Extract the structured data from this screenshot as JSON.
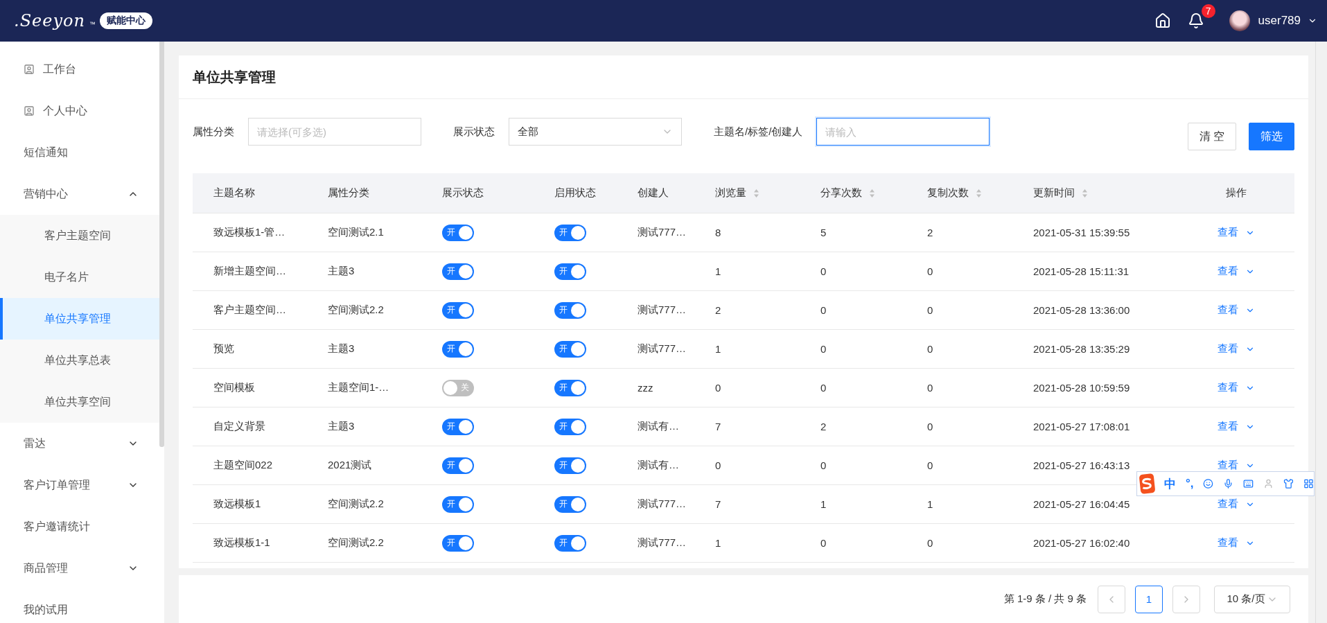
{
  "header": {
    "logo": ".Seeyon",
    "logo_mark": "™",
    "badge": "赋能中心",
    "notifications": "7",
    "user": "user789"
  },
  "sidebar": {
    "items": [
      {
        "label": "工作台",
        "kind": "icon",
        "selected": false
      },
      {
        "label": "个人中心",
        "kind": "icon",
        "selected": false
      },
      {
        "label": "短信通知",
        "kind": "plain",
        "selected": false
      },
      {
        "label": "营销中心",
        "kind": "group",
        "expanded": true,
        "selected": false,
        "children": [
          {
            "label": "客户主题空间",
            "selected": false
          },
          {
            "label": "电子名片",
            "selected": false
          },
          {
            "label": "单位共享管理",
            "selected": true
          },
          {
            "label": "单位共享总表",
            "selected": false
          },
          {
            "label": "单位共享空间",
            "selected": false
          }
        ]
      },
      {
        "label": "雷达",
        "kind": "group",
        "expanded": false,
        "selected": false
      },
      {
        "label": "客户订单管理",
        "kind": "group",
        "expanded": false,
        "selected": false
      },
      {
        "label": "客户邀请统计",
        "kind": "plain",
        "selected": false
      },
      {
        "label": "商品管理",
        "kind": "group",
        "expanded": false,
        "selected": false
      },
      {
        "label": "我的试用",
        "kind": "plain",
        "selected": false
      }
    ]
  },
  "page": {
    "title": "单位共享管理",
    "filters": [
      {
        "label": "属性分类",
        "kind": "input",
        "placeholder": "请选择(可多选)",
        "focused": false
      },
      {
        "label": "展示状态",
        "kind": "select",
        "value": "全部",
        "focused": false
      },
      {
        "label": "主题名/标签/创建人",
        "kind": "input",
        "placeholder": "请输入",
        "focused": true
      }
    ],
    "buttons": [
      {
        "label": "清 空",
        "kind": "default"
      },
      {
        "label": "筛选",
        "kind": "primary"
      }
    ],
    "table": {
      "columns": [
        {
          "label": "主题名称",
          "sortable": false
        },
        {
          "label": "属性分类",
          "sortable": false
        },
        {
          "label": "展示状态",
          "sortable": false
        },
        {
          "label": "启用状态",
          "sortable": false
        },
        {
          "label": "创建人",
          "sortable": false
        },
        {
          "label": "浏览量",
          "sortable": true
        },
        {
          "label": "分享次数",
          "sortable": true
        },
        {
          "label": "复制次数",
          "sortable": true
        },
        {
          "label": "更新时间",
          "sortable": true
        },
        {
          "label": "操作",
          "sortable": false
        }
      ],
      "rows": [
        {
          "name": "致远模板1-管…",
          "category": "空间测试2.1",
          "display": {
            "on": true,
            "label": "开"
          },
          "enabled": {
            "on": true,
            "label": "开"
          },
          "creator": "测试777…",
          "views": "8",
          "shares": "5",
          "copies": "2",
          "updated": "2021-05-31 15:39:55",
          "action": "查看"
        },
        {
          "name": "新增主题空间…",
          "category": "主题3",
          "display": {
            "on": true,
            "label": "开"
          },
          "enabled": {
            "on": true,
            "label": "开"
          },
          "views": "1",
          "shares": "0",
          "copies": "0",
          "updated": "2021-05-28 15:11:31",
          "action": "查看"
        },
        {
          "name": "客户主题空间…",
          "category": "空间测试2.2",
          "display": {
            "on": true,
            "label": "开"
          },
          "enabled": {
            "on": true,
            "label": "开"
          },
          "creator": "测试777…",
          "views": "2",
          "shares": "0",
          "copies": "0",
          "updated": "2021-05-28 13:36:00",
          "action": "查看"
        },
        {
          "name": "预览",
          "category": "主题3",
          "display": {
            "on": true,
            "label": "开"
          },
          "enabled": {
            "on": true,
            "label": "开"
          },
          "creator": "测试777…",
          "views": "1",
          "shares": "0",
          "copies": "0",
          "updated": "2021-05-28 13:35:29",
          "action": "查看"
        },
        {
          "name": "空间模板",
          "category": "主题空间1-…",
          "display": {
            "on": false,
            "label": "关"
          },
          "enabled": {
            "on": true,
            "label": "开"
          },
          "creator": "zzz",
          "views": "0",
          "shares": "0",
          "copies": "0",
          "updated": "2021-05-28 10:59:59",
          "action": "查看"
        },
        {
          "name": "自定义背景",
          "category": "主题3",
          "display": {
            "on": true,
            "label": "开"
          },
          "enabled": {
            "on": true,
            "label": "开"
          },
          "creator": "测试有…",
          "views": "7",
          "shares": "2",
          "copies": "0",
          "updated": "2021-05-27 17:08:01",
          "action": "查看"
        },
        {
          "name": "主题空间022",
          "category": "2021测试",
          "display": {
            "on": true,
            "label": "开"
          },
          "enabled": {
            "on": true,
            "label": "开"
          },
          "creator": "测试有…",
          "views": "0",
          "shares": "0",
          "copies": "0",
          "updated": "2021-05-27 16:43:13",
          "action": "查看"
        },
        {
          "name": "致远模板1",
          "category": "空间测试2.2",
          "display": {
            "on": true,
            "label": "开"
          },
          "enabled": {
            "on": true,
            "label": "开"
          },
          "creator": "测试777…",
          "views": "7",
          "shares": "1",
          "copies": "1",
          "updated": "2021-05-27 16:04:45",
          "action": "查看"
        },
        {
          "name": "致远模板1-1",
          "category": "空间测试2.2",
          "display": {
            "on": true,
            "label": "开"
          },
          "enabled": {
            "on": true,
            "label": "开"
          },
          "creator": "测试777…",
          "views": "1",
          "shares": "0",
          "copies": "0",
          "updated": "2021-05-27 16:02:40",
          "action": "查看"
        }
      ]
    },
    "pagination": {
      "summary": "第 1-9 条 / 共 9 条",
      "pages": [
        {
          "label": "1",
          "selected": true
        }
      ],
      "page_size": "10 条/页"
    }
  },
  "ime_toolbar": {
    "labels": [
      "中",
      "°,"
    ]
  }
}
